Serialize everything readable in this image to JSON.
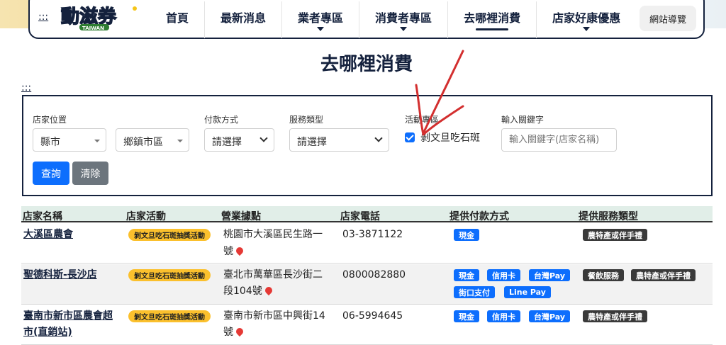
{
  "header": {
    "skip_link": ":::",
    "logo_alt": "動滋券 TAIWAN",
    "nav": [
      {
        "label": "首頁",
        "caret": false,
        "active": false
      },
      {
        "label": "最新消息",
        "caret": false,
        "active": false
      },
      {
        "label": "業者專區",
        "caret": true,
        "active": false
      },
      {
        "label": "消費者專區",
        "caret": true,
        "active": false
      },
      {
        "label": "去哪裡消費",
        "caret": false,
        "active": true
      },
      {
        "label": "店家好康優惠",
        "caret": true,
        "active": false
      }
    ],
    "sitemap": "網站導覽"
  },
  "page": {
    "title": "去哪裡消費",
    "skip_link": ":::"
  },
  "filter": {
    "location_label": "店家位置",
    "city_value": "縣市",
    "district_value": "鄉鎮市區",
    "payment_label": "付款方式",
    "payment_value": "請選擇",
    "service_label": "服務類型",
    "service_value": "請選擇",
    "activity_label": "活動專區",
    "activity_checkbox_label": "剝文旦吃石斑",
    "activity_checked": true,
    "keyword_label": "輸入關鍵字",
    "keyword_placeholder": "輸入關鍵字(店家名稱)",
    "search_button": "查詢",
    "clear_button": "清除"
  },
  "table": {
    "headers": [
      "店家名稱",
      "店家活動",
      "營業據點",
      "店家電話",
      "提供付款方式",
      "提供服務類型"
    ],
    "rows": [
      {
        "name_line1": "大溪區農會",
        "name_line2": "",
        "event": "剝文旦吃石斑抽獎活動",
        "addr_line1": "桃園市大溪區民生路一",
        "addr_line2": "號",
        "phone": "03-3871122",
        "payments": [
          "現金"
        ],
        "services": [
          "農特產或伴手禮"
        ]
      },
      {
        "name_line1": "聖德科斯-長沙店",
        "name_line2": "",
        "event": "剝文旦吃石斑抽獎活動",
        "addr_line1": "臺北市萬華區長沙街二",
        "addr_line2": "段104號",
        "phone": "0800082880",
        "payments": [
          "現金",
          "信用卡",
          "台灣Pay",
          "街口支付",
          "Line Pay"
        ],
        "services": [
          "餐飲服務",
          "農特產或伴手禮"
        ]
      },
      {
        "name_line1": "臺南市新市區農會超",
        "name_line2": "市(直銷站)",
        "event": "剝文旦吃石斑抽獎活動",
        "addr_line1": "臺南市新市區中興街14",
        "addr_line2": "號",
        "phone": "06-5994645",
        "payments": [
          "現金",
          "信用卡",
          "台灣Pay"
        ],
        "services": [
          "農特產或伴手禮"
        ]
      }
    ]
  },
  "colors": {
    "navy": "#14213d",
    "primary": "#0d6efd",
    "secondary": "#6c757d",
    "event_badge": "#fbc02d",
    "service_badge": "#3a3a3a",
    "annotation_arrow": "#d32f2f"
  },
  "icons": [
    "location-pin-icon",
    "chevron-down-icon",
    "checkbox-checked-icon"
  ]
}
